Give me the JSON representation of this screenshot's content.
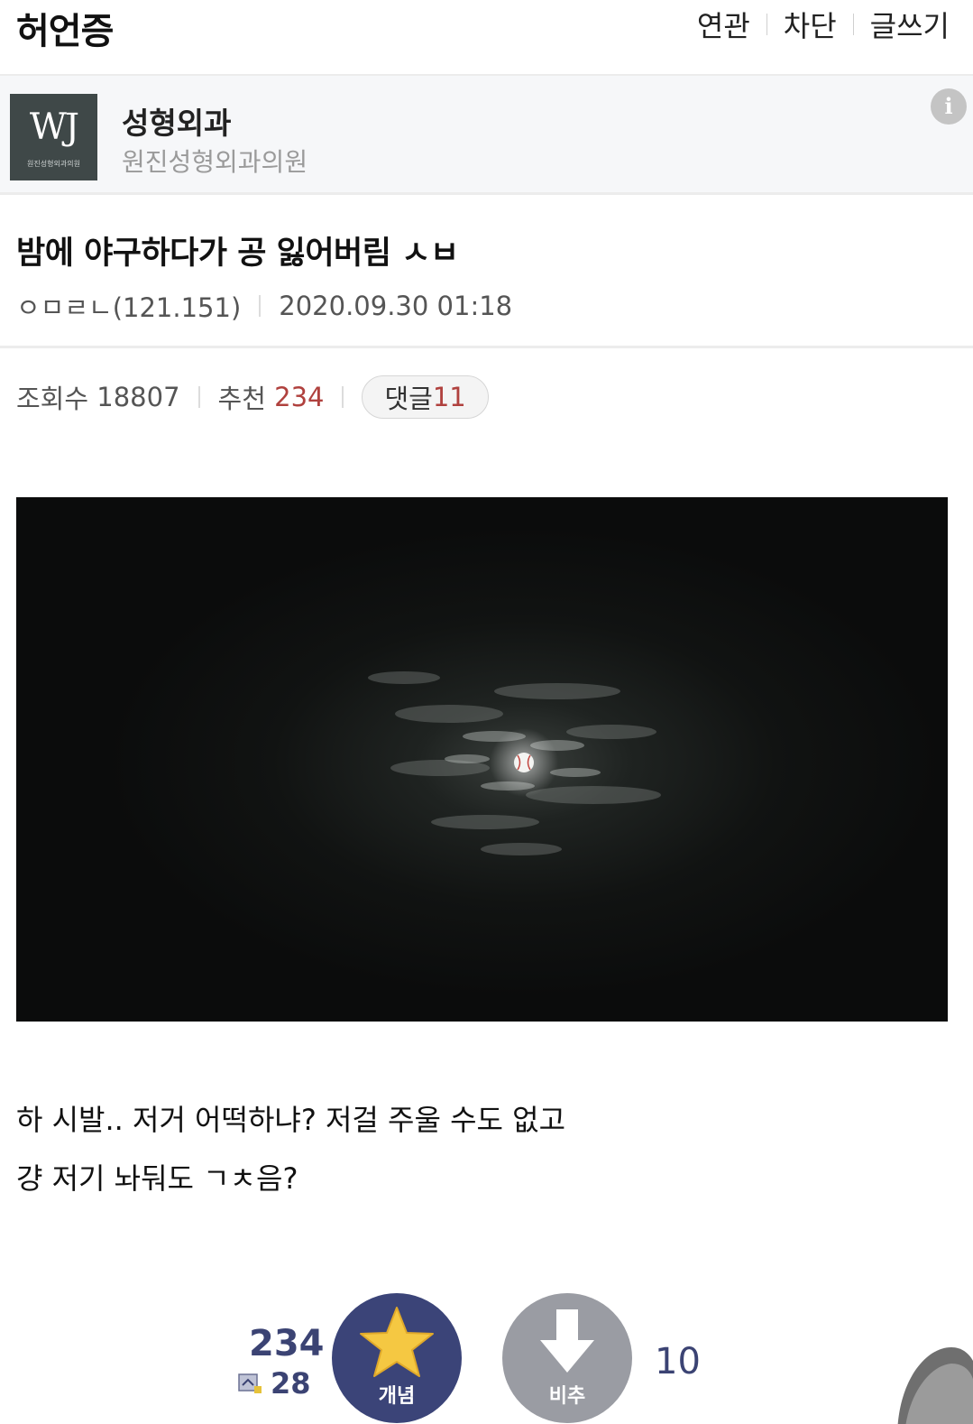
{
  "header": {
    "gallery_title": "허언증",
    "menu": [
      "연관",
      "차단",
      "글쓰기"
    ]
  },
  "ad": {
    "logo_text": "WJ",
    "logo_caption": "원진성형외과의원",
    "title": "성형외과",
    "subtitle": "원진성형외과의원",
    "info_icon": "info-icon"
  },
  "post": {
    "title": "밤에 야구하다가 공 잃어버림 ㅅㅂ",
    "author": "ㅇㅁㄹㄴ(121.151)",
    "date": "2020.09.30 01:18",
    "views_label": "조회수",
    "views": "18807",
    "recommend_label": "추천",
    "recommend": "234",
    "comments_label": "댓글",
    "comments": "11",
    "body": [
      "하 시발.. 저거 어떡하냐? 저걸 주울 수도 없고",
      "걍 저기 놔둬도 ㄱㅊ음?"
    ]
  },
  "vote": {
    "up_count": "234",
    "fix_count": "28",
    "up_label": "개념",
    "down_label": "비추",
    "down_count": "10",
    "up_icon": "star-icon",
    "down_icon": "arrow-down-icon",
    "colors": {
      "up": "#3b4478",
      "down": "#9a9ca3",
      "accent": "#b0413e",
      "star": "#f5c842"
    }
  }
}
